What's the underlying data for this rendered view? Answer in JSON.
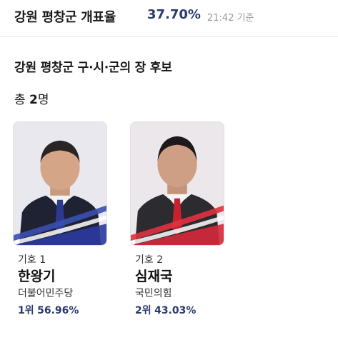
{
  "header": {
    "title": "강원 평창군 개표율",
    "rate": "37.70%",
    "time": "21:42 기준"
  },
  "section": {
    "title": "강원 평창군 구·시·군의 장 후보",
    "count_prefix": "총",
    "count_value": "2",
    "count_suffix": "명"
  },
  "candidates": [
    {
      "number": "기호 1",
      "name": "한왕기",
      "party": "더불어민주당",
      "rank": "1위",
      "percent": "56.96%",
      "party_color": "#2b3a9e"
    },
    {
      "number": "기호 2",
      "name": "심재국",
      "party": "국민의힘",
      "rank": "2위",
      "percent": "43.03%",
      "party_color": "#d6283a"
    }
  ],
  "colors": {
    "accent": "#2b3a6e",
    "muted": "#9a9a9a"
  }
}
